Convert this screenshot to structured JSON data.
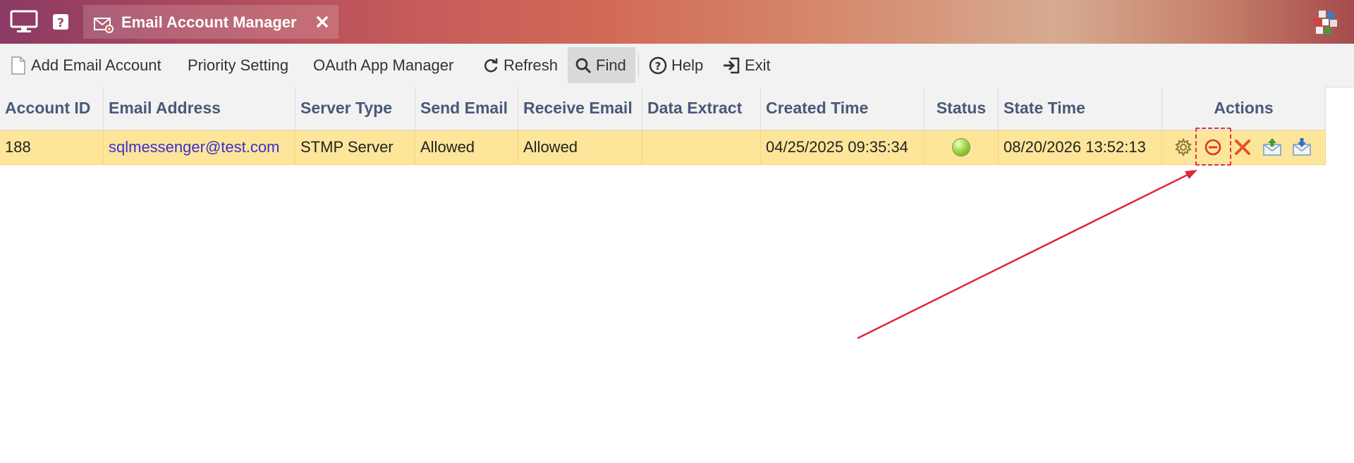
{
  "window": {
    "tab_title": "Email Account Manager",
    "icons": {
      "desktop": "monitor-icon",
      "help": "question-icon",
      "tab": "mail-settings-icon",
      "close": "close-icon",
      "logo": "app-logo"
    }
  },
  "toolbar": {
    "buttons": [
      {
        "label": "Add Email Account",
        "icon": "document-icon"
      },
      {
        "label": "Priority Setting"
      },
      {
        "label": "OAuth App Manager"
      },
      {
        "label": "Refresh",
        "icon": "refresh-icon"
      },
      {
        "label": "Find",
        "icon": "search-icon",
        "active": true
      },
      {
        "label": "Help",
        "icon": "help-circle-icon"
      },
      {
        "label": "Exit",
        "icon": "exit-icon"
      }
    ]
  },
  "table": {
    "columns": [
      "Account ID",
      "Email Address",
      "Server Type",
      "Send Email",
      "Receive Email",
      "Data Extract",
      "Created Time",
      "Status",
      "State Time",
      "Actions"
    ],
    "rows": [
      {
        "account_id": "188",
        "email": "sqlmessenger@test.com",
        "server_type": "STMP Server",
        "send_email": "Allowed",
        "receive_email": "Allowed",
        "data_extract": "",
        "created_time": "04/25/2025 09:35:34",
        "status": "active",
        "state_time": "08/20/2026 13:52:13",
        "actions": [
          "settings-gear-icon",
          "disable-minus-icon",
          "delete-x-icon",
          "send-mail-upload-icon",
          "receive-mail-download-icon"
        ]
      }
    ]
  },
  "colors": {
    "selected_row": "#fde59a",
    "header_text": "#4a5878",
    "link": "#3b2fd0",
    "annotation": "#e0334a"
  }
}
